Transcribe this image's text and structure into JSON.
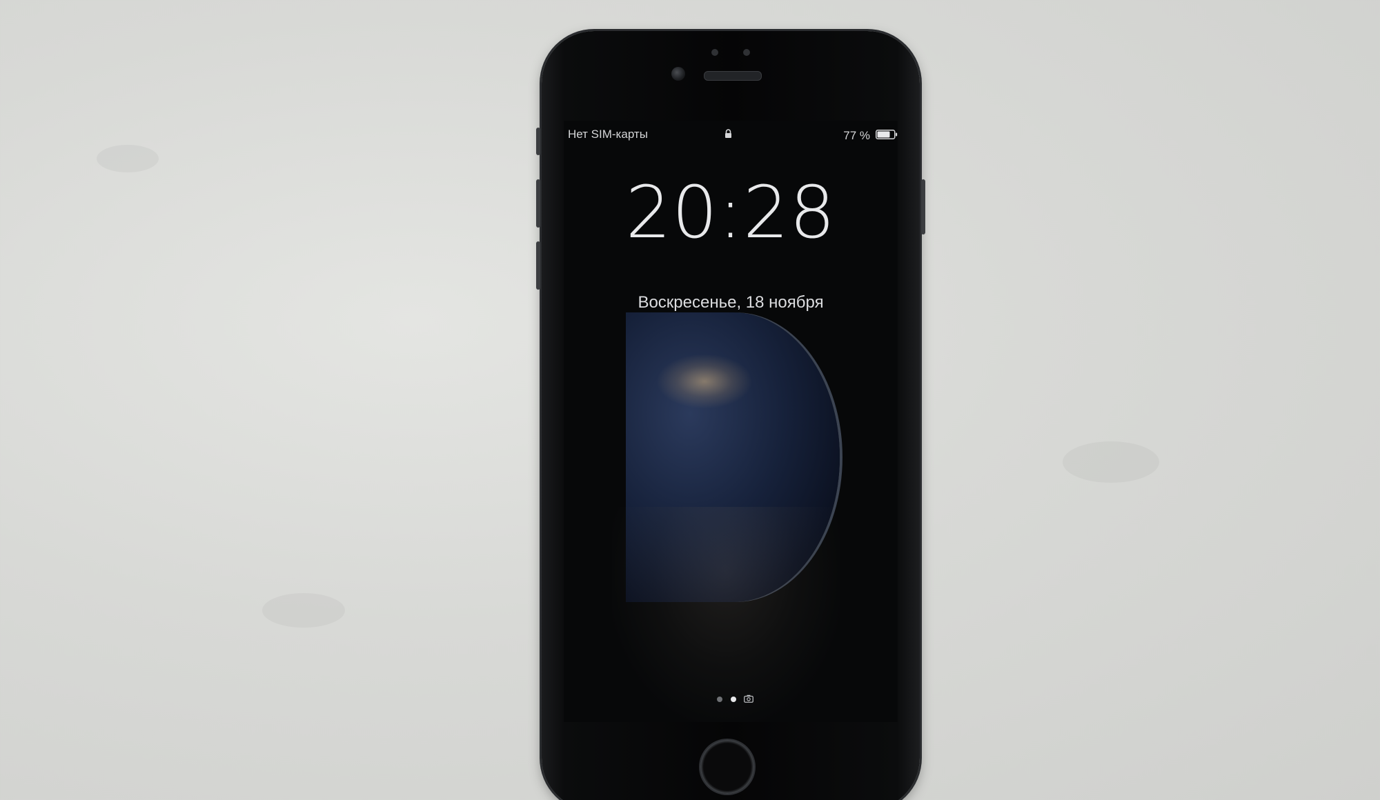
{
  "colors": {
    "table_surface": "#d8d9d6",
    "phone_body": "#050506",
    "screen_background": "#070809",
    "lock_screen_text": "#e8e9eb"
  },
  "lock_screen": {
    "status_bar": {
      "carrier": "Нет SIM-карты",
      "lock_icon": "lock-icon",
      "battery_percent": "77 %",
      "battery_icon": "battery-icon"
    },
    "time": "20:28",
    "date": "Воскресенье, 18 ноября",
    "page_indicator": {
      "dots": 2,
      "active_dot": 2,
      "camera_icon": "camera-icon"
    }
  }
}
